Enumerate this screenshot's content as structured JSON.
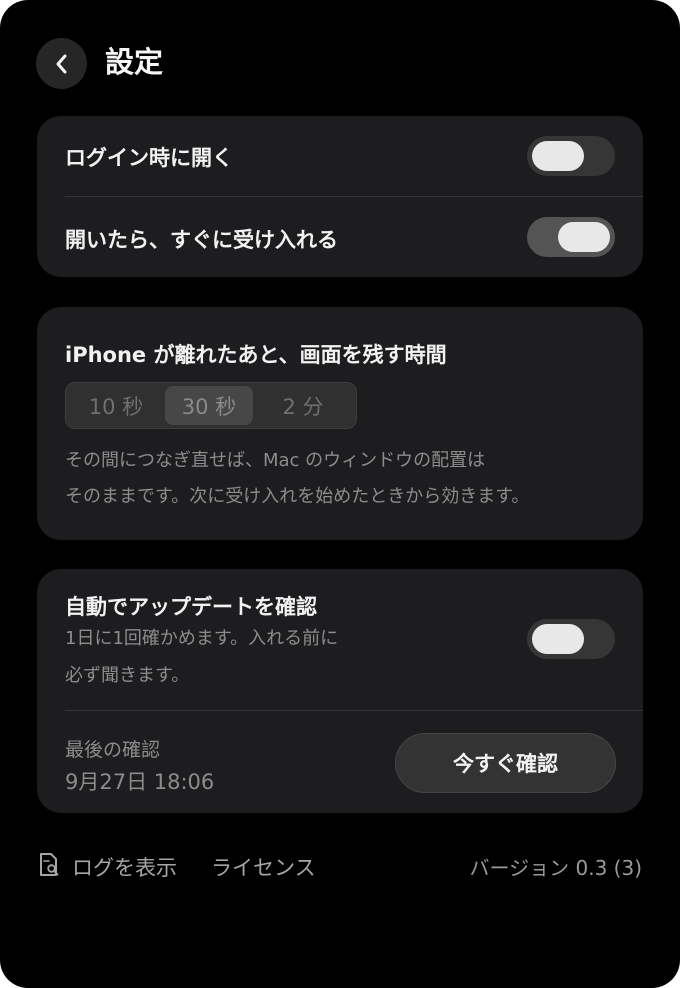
{
  "header": {
    "title": "設定"
  },
  "general": {
    "open_at_login": {
      "label": "ログイン時に開く",
      "state": "off"
    },
    "accept_on_open": {
      "label": "開いたら、すぐに受け入れる",
      "state": "on"
    }
  },
  "keep_screen": {
    "title": "iPhone が離れたあと、画面を残す時間",
    "options": [
      "10 秒",
      "30 秒",
      "2 分"
    ],
    "selected": "30 秒",
    "desc_line1": "その間につなぎ直せば、Mac のウィンドウの配置は",
    "desc_line2": "そのままです。次に受け入れを始めたときから効きます。"
  },
  "update": {
    "title": "自動でアップデートを確認",
    "desc_line1": "1日に1回確かめます。入れる前に",
    "desc_line2": "必ず聞きます。",
    "state": "off",
    "last_check_label": "最後の確認",
    "last_check_value": "9月27日 18:06",
    "check_now_label": "今すぐ確認"
  },
  "footer": {
    "show_log_label": "ログを表示",
    "license_label": "ライセンス",
    "version": "バージョン 0.3 (3)"
  },
  "colors": {
    "window_bg": "#000000",
    "card_bg": "#1d1d1f",
    "text": "#f2f2f2",
    "muted": "#8c8c8c"
  }
}
